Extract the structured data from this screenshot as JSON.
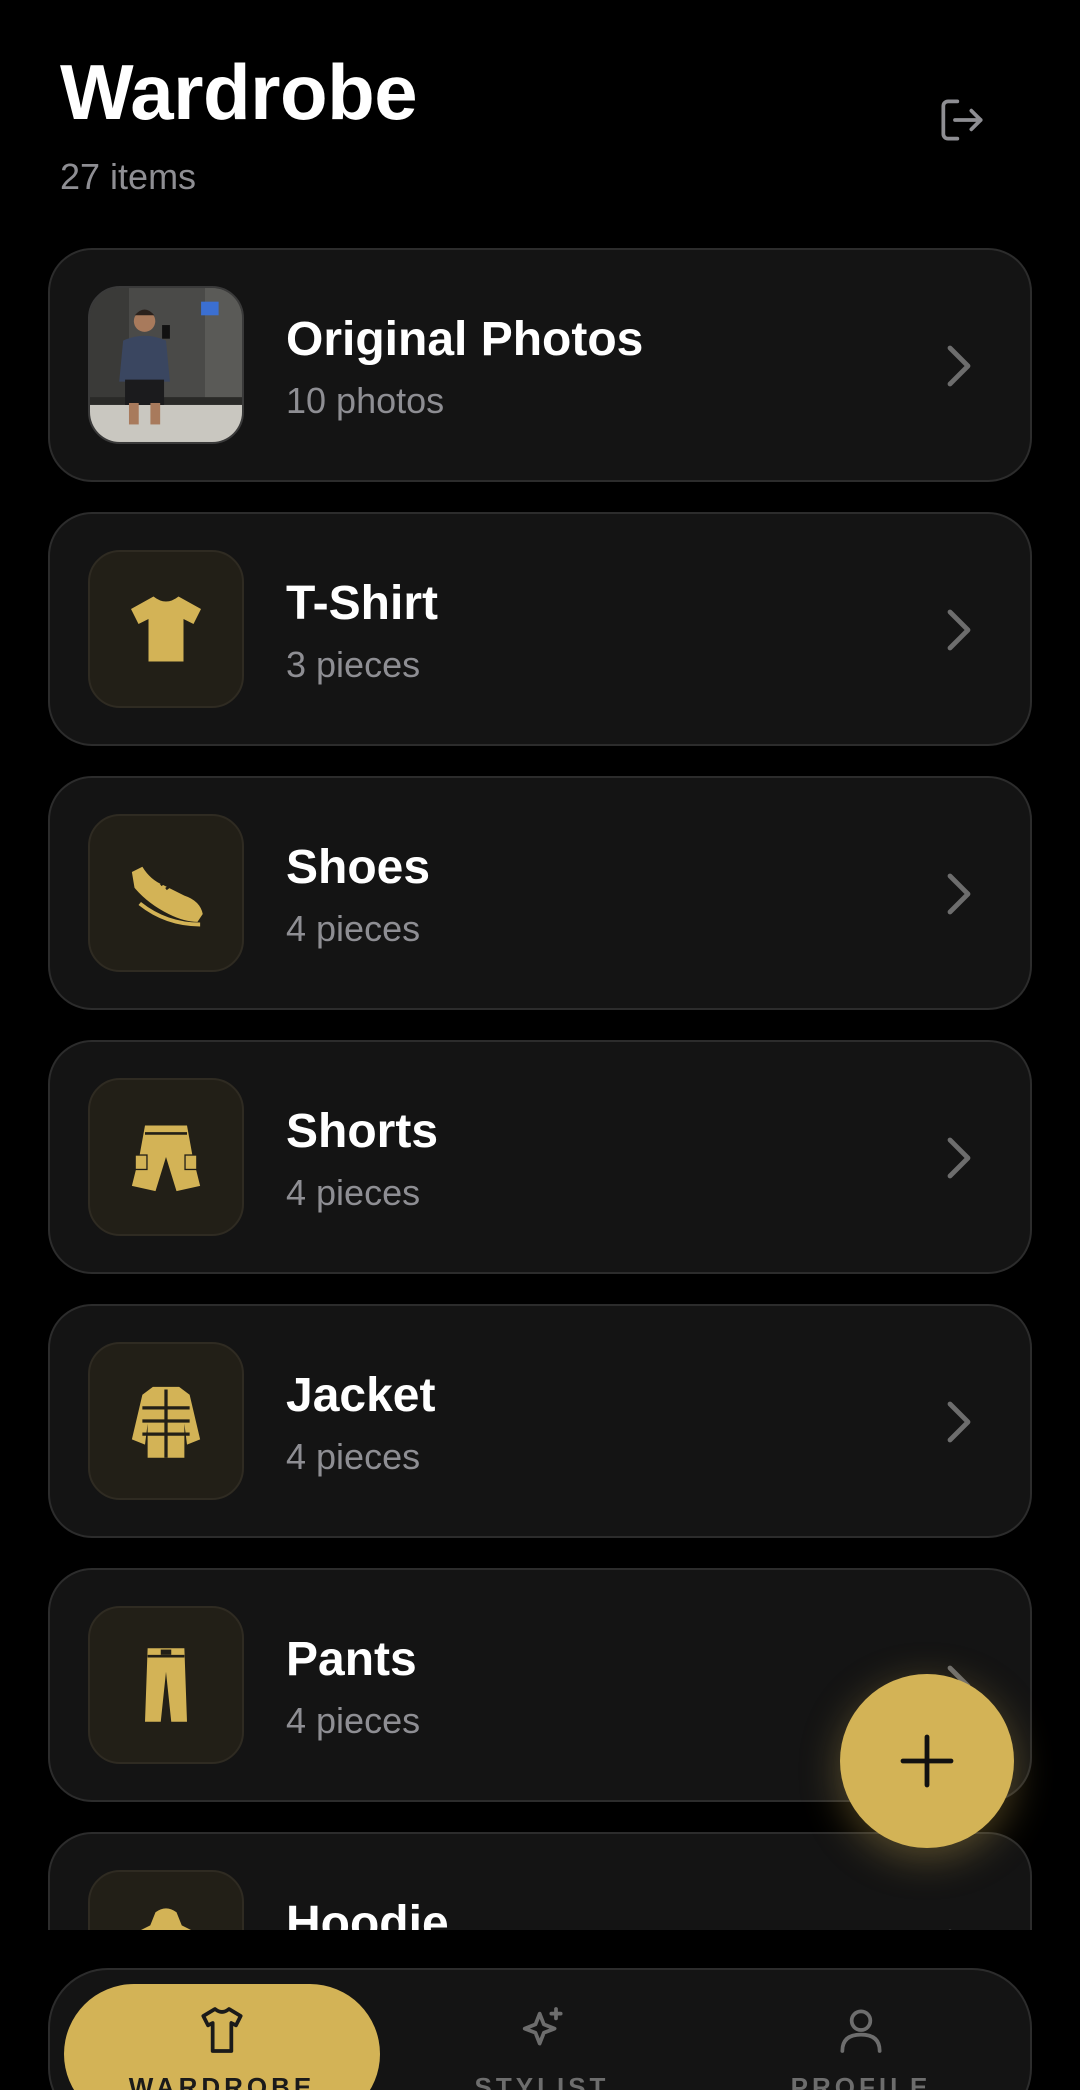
{
  "header": {
    "title": "Wardrobe",
    "item_count": "27 items"
  },
  "categories": [
    {
      "title": "Original Photos",
      "subtitle": "10 photos",
      "icon": "photo-thumbnail"
    },
    {
      "title": "T-Shirt",
      "subtitle": "3 pieces",
      "icon": "tshirt-icon"
    },
    {
      "title": "Shoes",
      "subtitle": "4 pieces",
      "icon": "shoe-icon"
    },
    {
      "title": "Shorts",
      "subtitle": "4 pieces",
      "icon": "shorts-icon"
    },
    {
      "title": "Jacket",
      "subtitle": "4 pieces",
      "icon": "jacket-icon"
    },
    {
      "title": "Pants",
      "subtitle": "4 pieces",
      "icon": "pants-icon"
    },
    {
      "title": "Hoodie",
      "subtitle": "",
      "icon": "hoodie-icon"
    }
  ],
  "nav": {
    "items": [
      {
        "label": "WARDROBE",
        "icon": "tshirt-icon",
        "active": true
      },
      {
        "label": "STYLIST",
        "icon": "sparkle-icon",
        "active": false
      },
      {
        "label": "PROFILE",
        "icon": "user-icon",
        "active": false
      }
    ]
  },
  "colors": {
    "accent": "#d3b356",
    "background": "#000000",
    "card": "#141414",
    "muted_text": "#8e8e93"
  }
}
